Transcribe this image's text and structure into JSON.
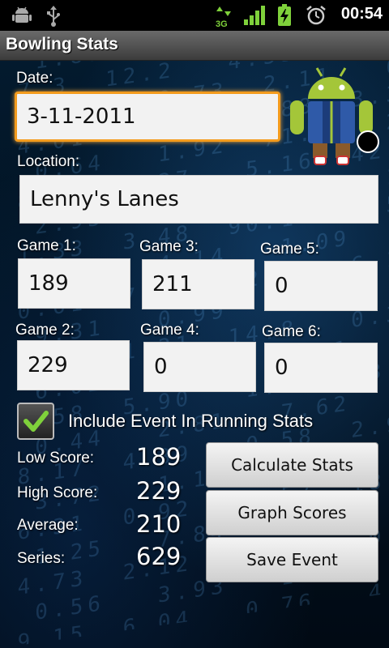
{
  "status_bar": {
    "time": "00:54",
    "network": "3G",
    "icons": [
      "android-debug-icon",
      "usb-icon",
      "network-3g-icon",
      "signal-icon",
      "battery-charging-icon",
      "alarm-icon"
    ]
  },
  "app": {
    "title": "Bowling Stats"
  },
  "form": {
    "date_label": "Date:",
    "date_value": "3-11-2011",
    "location_label": "Location:",
    "location_value": "Lenny's Lanes",
    "games": [
      {
        "label": "Game 1:",
        "value": "189"
      },
      {
        "label": "Game 2:",
        "value": "229"
      },
      {
        "label": "Game 3:",
        "value": "211"
      },
      {
        "label": "Game 4:",
        "value": "0"
      },
      {
        "label": "Game 5:",
        "value": "0"
      },
      {
        "label": "Game 6:",
        "value": "0"
      }
    ],
    "include_label": "Include Event In Running Stats",
    "include_checked": true
  },
  "stats": {
    "low_label": "Low Score:",
    "low_value": "189",
    "high_label": "High Score:",
    "high_value": "229",
    "avg_label": "Average:",
    "avg_value": "210",
    "series_label": "Series:",
    "series_value": "629"
  },
  "buttons": {
    "calculate": "Calculate Stats",
    "graph": "Graph Scores",
    "save": "Save Event"
  },
  "colors": {
    "focus_border": "#f39b1d",
    "background": "#02101c",
    "check": "#7fd13b"
  }
}
